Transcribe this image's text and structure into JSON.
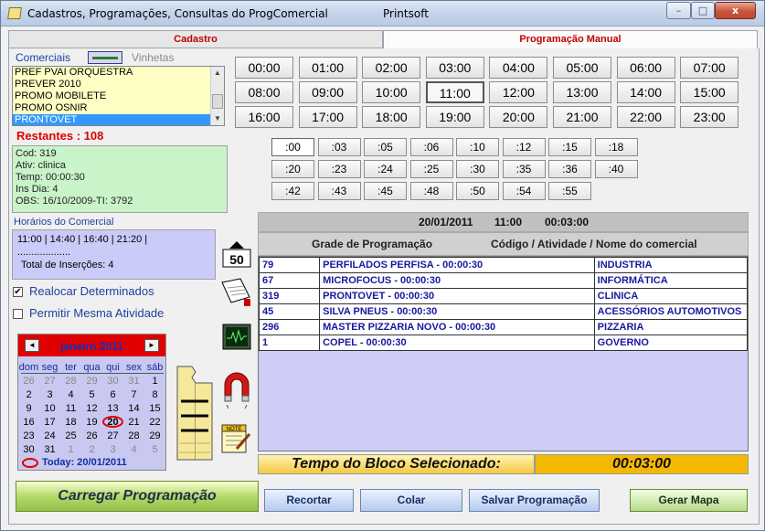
{
  "window": {
    "title": "Cadastros, Programações, Consultas do ProgComercial",
    "subtitle": "Printsoft",
    "min": "–",
    "max": "□",
    "close": "x"
  },
  "tabs": [
    "Cadastro",
    "Programação Manual"
  ],
  "left": {
    "comerciais_label": "Comerciais",
    "vinhetas_label": "Vinhetas",
    "list_items": [
      "PREF PVAI ORQUESTRA",
      "PREVER 2010",
      "PROMO MOBILETE",
      "PROMO OSNIR",
      "PRONTOVET"
    ],
    "selected_item": "PRONTOVET",
    "restantes": "Restantes  : 108",
    "info": {
      "cod": "Cod:   319",
      "ativ": "Ativ:   clinica",
      "temp": "Temp:  00:00:30",
      "ins_dia": "Ins Dia:   4",
      "obs": "OBS:    16/10/2009-TI: 3792"
    },
    "horarios_label": "Horários do Comercial",
    "horarios_line": "11:00 | 14:40 | 16:40 | 21:20 |",
    "horarios_dots": "...................",
    "total_insercoes": "Total de Inserções: 4",
    "realocar_label": "Realocar Determinados",
    "realocar_checked": "✔",
    "permitir_label": "Permitir Mesma Atividade"
  },
  "calendar": {
    "month": "janeiro 2011",
    "prev": "◄",
    "next": "►",
    "weekdays": [
      "dom",
      "seg",
      "ter",
      "qua",
      "qui",
      "sex",
      "sáb"
    ],
    "weeks": [
      [
        "26",
        "27",
        "28",
        "29",
        "30",
        "31",
        "1"
      ],
      [
        "2",
        "3",
        "4",
        "5",
        "6",
        "7",
        "8"
      ],
      [
        "9",
        "10",
        "11",
        "12",
        "13",
        "14",
        "15"
      ],
      [
        "16",
        "17",
        "18",
        "19",
        "20",
        "21",
        "22"
      ],
      [
        "23",
        "24",
        "25",
        "26",
        "27",
        "28",
        "29"
      ],
      [
        "30",
        "31",
        "1",
        "2",
        "3",
        "4",
        "5"
      ]
    ],
    "selected_day": "20",
    "today_label": "Today: 20/01/2011"
  },
  "hours": [
    "00:00",
    "01:00",
    "02:00",
    "03:00",
    "04:00",
    "05:00",
    "06:00",
    "07:00",
    "08:00",
    "09:00",
    "10:00",
    "11:00",
    "12:00",
    "13:00",
    "14:00",
    "15:00",
    "16:00",
    "17:00",
    "18:00",
    "19:00",
    "20:00",
    "21:00",
    "22:00",
    "23:00"
  ],
  "selected_hour": "11:00",
  "minutes": [
    ":00",
    ":03",
    ":05",
    ":06",
    ":10",
    ":12",
    ":15",
    ":18",
    ":20",
    ":23",
    ":24",
    ":25",
    ":30",
    ":35",
    ":36",
    ":40",
    ":42",
    ":43",
    ":45",
    ":48",
    ":50",
    ":54",
    ":55"
  ],
  "selected_minute": ":00",
  "block": {
    "date": "20/01/2011",
    "hour": "11:00",
    "duration": "00:03:00",
    "col1": "Grade de Programação",
    "col2": "Código / Atividade / Nome do comercial"
  },
  "grid_rows": [
    {
      "code": "79",
      "name": "PERFILADOS PERFISA - 00:00:30",
      "activity": "INDUSTRIA"
    },
    {
      "code": "67",
      "name": "MICROFOCUS - 00:00:30",
      "activity": "INFORMÁTICA"
    },
    {
      "code": "319",
      "name": "PRONTOVET - 00:00:30",
      "activity": "CLINICA"
    },
    {
      "code": "45",
      "name": "SILVA PNEUS - 00:00:30",
      "activity": "ACESSÓRIOS AUTOMOTIVOS"
    },
    {
      "code": "296",
      "name": "MASTER PIZZARIA NOVO - 00:00:30",
      "activity": "PIZZARIA"
    },
    {
      "code": "1",
      "name": "COPEL - 00:00:30",
      "activity": "GOVERNO"
    }
  ],
  "tempo_label": "Tempo do Bloco Selecionado:",
  "tempo_value": "00:03:00",
  "buttons": {
    "carregar": "Carregar Programação",
    "recortar": "Recortar",
    "colar": "Colar",
    "salvar": "Salvar Programação",
    "gerar": "Gerar Mapa"
  },
  "icons": {
    "fifty": "50",
    "notepad": "NOTE"
  },
  "colors": {
    "accent_red": "#e00000",
    "list_bg": "#ffffc4",
    "info_bg": "#c9f3c9",
    "horarios_bg": "#cbcbfa",
    "selection": "#3399ff"
  }
}
